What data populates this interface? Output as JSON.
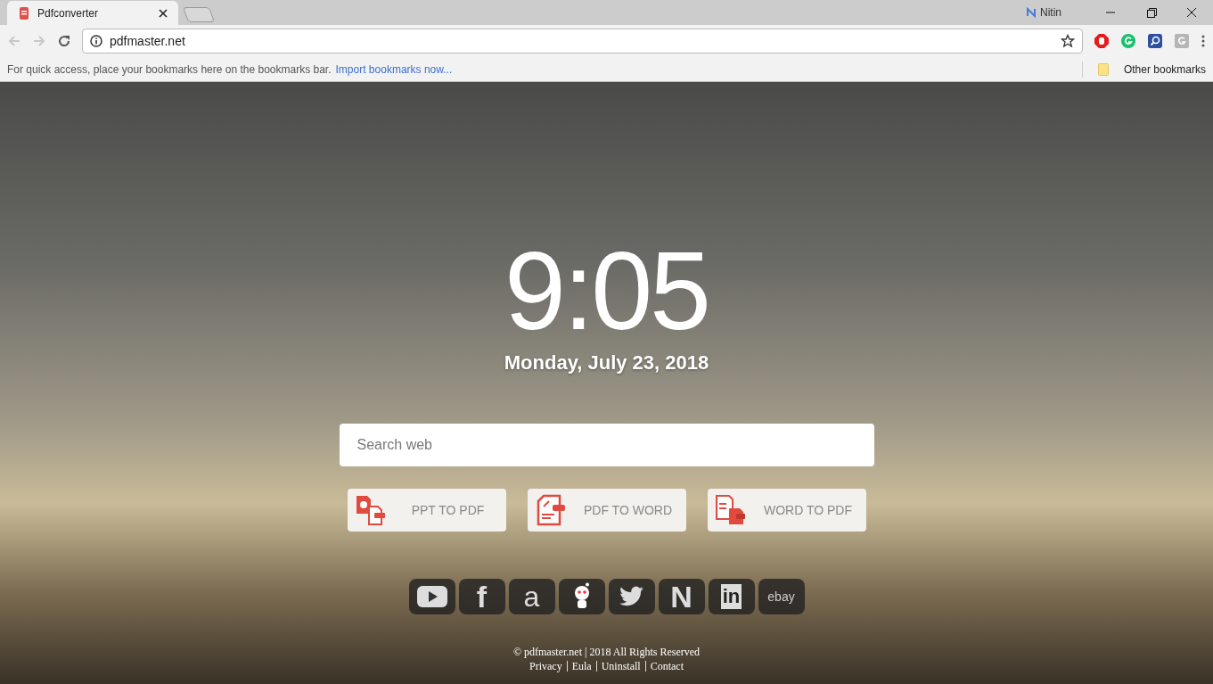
{
  "browser": {
    "tab": {
      "title": "Pdfconverter",
      "selected": true
    },
    "profile": "Nitin",
    "address": "pdfmaster.net",
    "bookmarks_bar": {
      "hint": "For quick access, place your bookmarks here on the bookmarks bar.",
      "import_link": "Import bookmarks now...",
      "other": "Other bookmarks"
    }
  },
  "page": {
    "time": "9:05",
    "date": "Monday, July 23, 2018",
    "search": {
      "placeholder": "Search web"
    },
    "converters": [
      {
        "label": "PPT TO PDF"
      },
      {
        "label": "PDF TO WORD"
      },
      {
        "label": "WORD TO PDF"
      }
    ],
    "shortcuts": [
      {
        "kind": "youtube"
      },
      {
        "kind": "letter",
        "glyph": "f"
      },
      {
        "kind": "amazon",
        "glyph": "a"
      },
      {
        "kind": "reddit"
      },
      {
        "kind": "twitter"
      },
      {
        "kind": "letter",
        "glyph": "N"
      },
      {
        "kind": "linkedin",
        "glyph": "in"
      },
      {
        "kind": "word",
        "glyph": "ebay"
      }
    ],
    "footer": {
      "copyright": "© pdfmaster.net | 2018 All Rights Reserved",
      "links": [
        "Privacy",
        "Eula",
        "Uninstall",
        "Contact"
      ]
    }
  }
}
